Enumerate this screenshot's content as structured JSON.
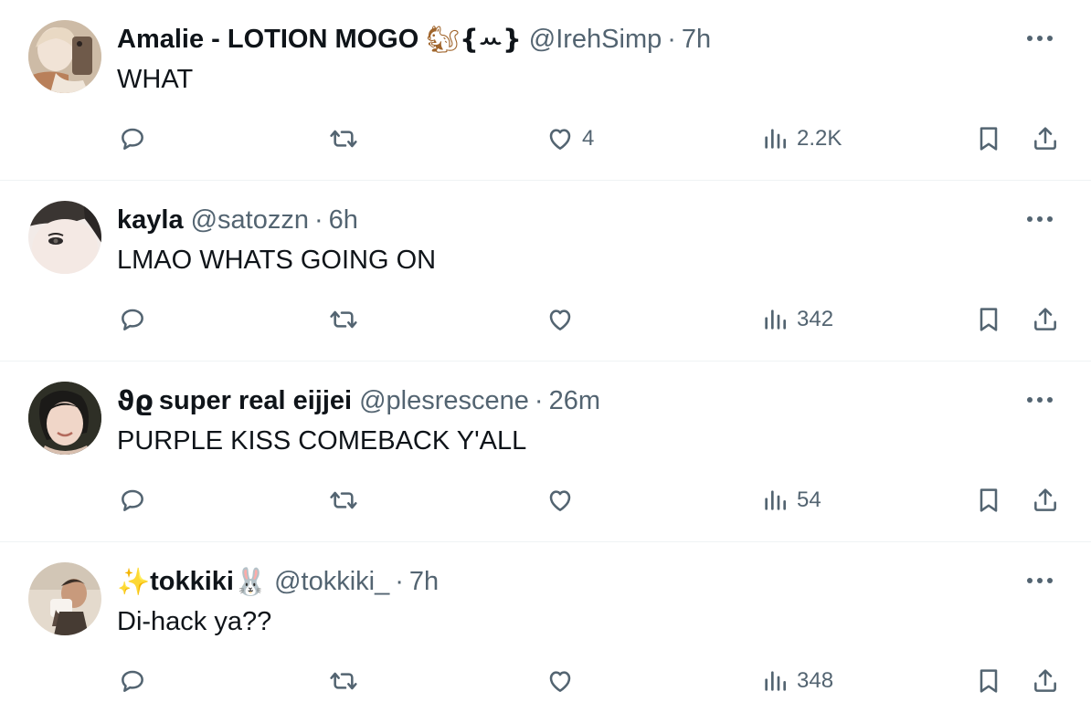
{
  "tweets": [
    {
      "name": "Amalie - LOTION MOGO",
      "name_emoji": "🐿",
      "name_suffix": "{ꕀ}",
      "handle": "@IrehSimp",
      "separator": "·",
      "time": "7h",
      "text": "WHAT",
      "likes": "4",
      "views": "2.2K",
      "avatar_colors": [
        "#c9b49a",
        "#8a6b52",
        "#f3e6da"
      ]
    },
    {
      "name": "kayla",
      "handle": "@satozzn",
      "separator": "·",
      "time": "6h",
      "text": "LMAO WHATS GOING ON",
      "likes": "",
      "views": "342",
      "avatar_colors": [
        "#e9dfdc",
        "#2a2625",
        "#f6eeea"
      ]
    },
    {
      "name_prefix": "ϑϱ",
      "name": "super real eijjei",
      "handle": "@plesrescene",
      "separator": "·",
      "time": "26m",
      "text": "PURPLE KISS COMEBACK Y'ALL",
      "likes": "",
      "views": "54",
      "avatar_colors": [
        "#3b3f2e",
        "#1a1a18",
        "#f0d6c8"
      ]
    },
    {
      "name_emoji_prefix": "✨",
      "name": "tokkiki",
      "name_emoji": "🐰",
      "handle": "@tokkiki_",
      "separator": "·",
      "time": "7h",
      "text": "Di-hack ya??",
      "likes": "",
      "views": "348",
      "avatar_colors": [
        "#d8cdbf",
        "#4a3f36",
        "#efe6db"
      ]
    }
  ],
  "icons": {
    "reply": "reply-icon",
    "retweet": "retweet-icon",
    "like": "like-icon",
    "views": "views-icon",
    "bookmark": "bookmark-icon",
    "share": "share-icon",
    "more": "more-icon"
  },
  "colors": {
    "text_primary": "#0f1419",
    "text_secondary": "#536471",
    "divider": "#eff3f4"
  }
}
